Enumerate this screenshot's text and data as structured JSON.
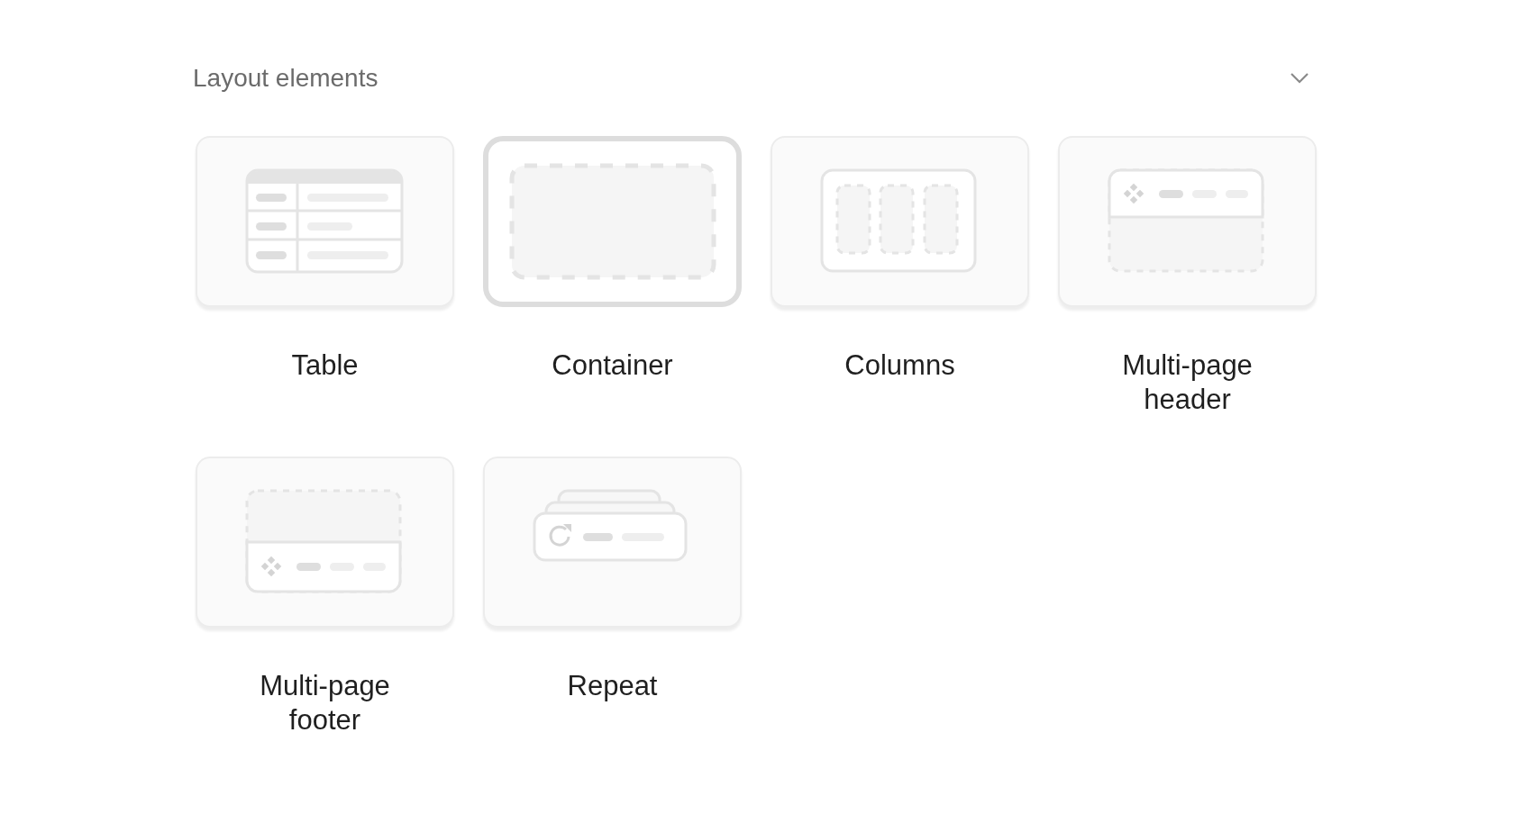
{
  "section": {
    "title": "Layout elements",
    "expanded": true
  },
  "items": [
    {
      "label": "Table",
      "kind": "table",
      "selected": false
    },
    {
      "label": "Container",
      "kind": "container",
      "selected": true
    },
    {
      "label": "Columns",
      "kind": "columns",
      "selected": false
    },
    {
      "label": "Multi-page header",
      "kind": "header",
      "selected": false
    },
    {
      "label": "Multi-page footer",
      "kind": "footer",
      "selected": false
    },
    {
      "label": "Repeat",
      "kind": "repeat",
      "selected": false
    }
  ]
}
